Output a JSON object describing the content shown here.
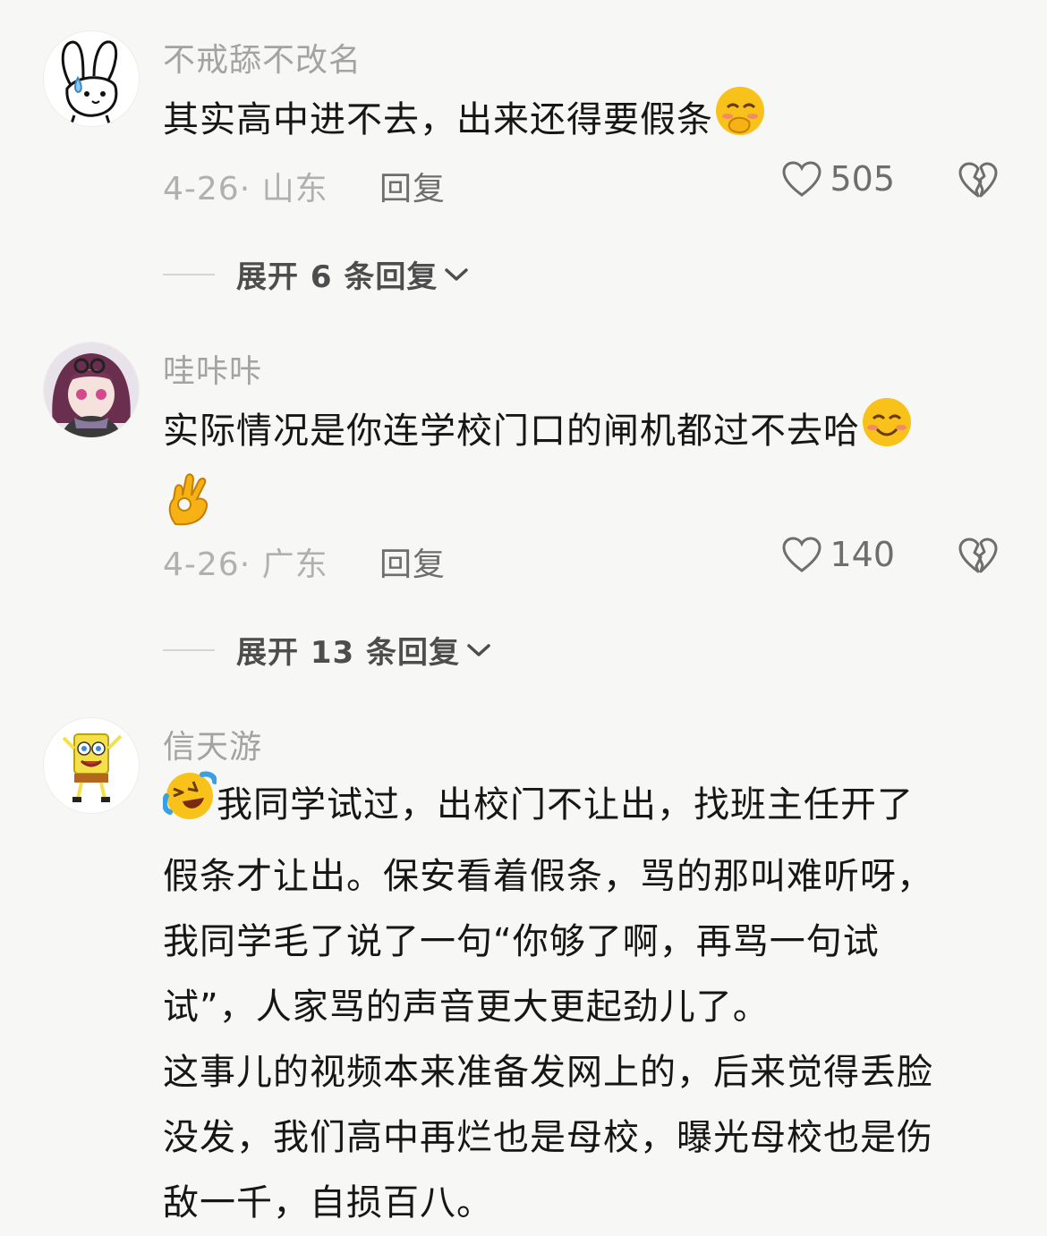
{
  "comments": [
    {
      "username": "不戒舔不改名",
      "text": "其实高中进不去，出来还得要假条",
      "date_location": "4-26· 山东",
      "reply_label": "回复",
      "likes": "505",
      "expand_label": "展开 6 条回复",
      "avatar_icon": "rabbit-sweat-avatar",
      "trailing_emoji": "shy-face-emoji"
    },
    {
      "username": "哇咔咔",
      "text": "实际情况是你连学校门口的闸机都过不去哈",
      "date_location": "4-26· 广东",
      "reply_label": "回复",
      "likes": "140",
      "expand_label": "展开 13 条回复",
      "avatar_icon": "anime-girl-avatar",
      "trailing_emoji": "smile-emoji",
      "second_line_emoji": "ok-hand-emoji"
    },
    {
      "username": "信天游",
      "avatar_icon": "spongebob-avatar",
      "leading_emoji": "laugh-cry-emoji",
      "lines": [
        "我同学试过，出校门不让出，找班主任开了",
        "假条才让出。保安看着假条，骂的那叫难听呀，",
        "我同学毛了说了一句“你够了啊，再骂一句试",
        "试”，人家骂的声音更大更起劲儿了。",
        "这事儿的视频本来准备发网上的，后来觉得丢脸",
        "没发，我们高中再烂也是母校，曝光母校也是伤",
        "敌一千，自损百八。"
      ]
    }
  ],
  "colors": {
    "background": "#f7f7f5",
    "username": "#a3a3a3",
    "body_text": "#161616",
    "meta": "#b0b0b0",
    "action": "#6e6e6e"
  }
}
